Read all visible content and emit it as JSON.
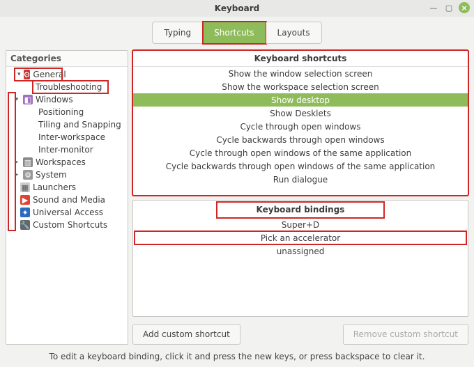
{
  "title": "Keyboard",
  "tabs": {
    "typing": "Typing",
    "shortcuts": "Shortcuts",
    "layouts": "Layouts"
  },
  "categories_header": "Categories",
  "tree": {
    "general": "General",
    "troubleshooting": "Troubleshooting",
    "windows": "Windows",
    "positioning": "Positioning",
    "tiling": "Tiling and Snapping",
    "interws": "Inter-workspace",
    "intermon": "Inter-monitor",
    "workspaces": "Workspaces",
    "system": "System",
    "launchers": "Launchers",
    "sound": "Sound and Media",
    "ua": "Universal Access",
    "custom": "Custom Shortcuts"
  },
  "shortcuts_header": "Keyboard shortcuts",
  "shortcuts": {
    "r0": "Show the window selection screen",
    "r1": "Show the workspace selection screen",
    "r2": "Show desktop",
    "r3": "Show Desklets",
    "r4": "Cycle through open windows",
    "r5": "Cycle backwards through open windows",
    "r6": "Cycle through open windows of the same application",
    "r7": "Cycle backwards through open windows of the same application",
    "r8": "Run dialogue"
  },
  "bindings_header": "Keyboard bindings",
  "bindings": {
    "b0": "Super+D",
    "b1": "Pick an accelerator",
    "b2": "unassigned"
  },
  "buttons": {
    "add": "Add custom shortcut",
    "remove": "Remove custom shortcut"
  },
  "footer": "To edit a keyboard binding, click it and press the new keys, or press backspace to clear it."
}
